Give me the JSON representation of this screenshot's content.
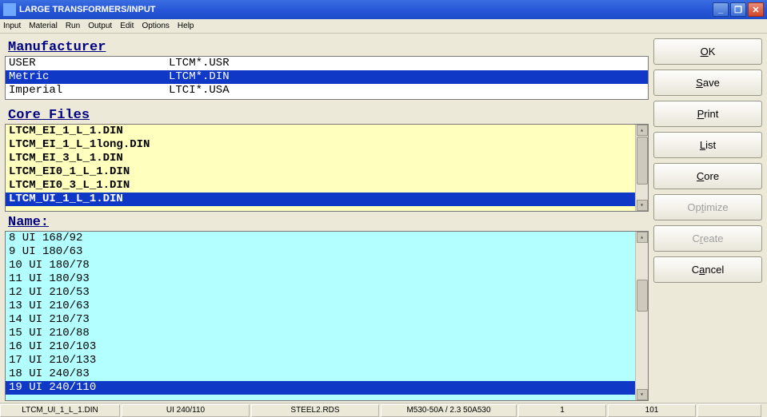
{
  "window": {
    "title": "LARGE TRANSFORMERS/INPUT"
  },
  "menu": {
    "items": [
      "Input",
      "Material",
      "Run",
      "Output",
      "Edit",
      "Options",
      "Help"
    ]
  },
  "sections": {
    "manufacturer_label": "Manufacturer",
    "corefiles_label": "Core Files",
    "name_label": "Name:"
  },
  "manufacturer": {
    "rows": [
      {
        "name": "USER",
        "pattern": "LTCM*.USR",
        "selected": false
      },
      {
        "name": "Metric",
        "pattern": "LTCM*.DIN",
        "selected": true
      },
      {
        "name": "Imperial",
        "pattern": "LTCI*.USA",
        "selected": false
      }
    ]
  },
  "core_files": {
    "rows": [
      {
        "name": "LTCM_EI_1_L_1.DIN",
        "selected": false
      },
      {
        "name": "LTCM_EI_1_L_1long.DIN",
        "selected": false
      },
      {
        "name": "LTCM_EI_3_L_1.DIN",
        "selected": false
      },
      {
        "name": "LTCM_EI0_1_L_1.DIN",
        "selected": false
      },
      {
        "name": "LTCM_EI0_3_L_1.DIN",
        "selected": false
      },
      {
        "name": "LTCM_UI_1_L_1.DIN",
        "selected": true
      }
    ]
  },
  "names": {
    "rows": [
      {
        "text": "8 UI 168/92",
        "selected": false
      },
      {
        "text": "9 UI 180/63",
        "selected": false
      },
      {
        "text": "10 UI 180/78",
        "selected": false
      },
      {
        "text": "11 UI 180/93",
        "selected": false
      },
      {
        "text": "12 UI 210/53",
        "selected": false
      },
      {
        "text": "13 UI 210/63",
        "selected": false
      },
      {
        "text": "14 UI 210/73",
        "selected": false
      },
      {
        "text": "15 UI 210/88",
        "selected": false
      },
      {
        "text": "16 UI 210/103",
        "selected": false
      },
      {
        "text": "17 UI 210/133",
        "selected": false
      },
      {
        "text": "18 UI 240/83",
        "selected": false
      },
      {
        "text": "19 UI 240/110",
        "selected": true
      }
    ]
  },
  "buttons": {
    "ok": {
      "pre": "",
      "u": "O",
      "post": "K",
      "disabled": false
    },
    "save": {
      "pre": "",
      "u": "S",
      "post": "ave",
      "disabled": false
    },
    "print": {
      "pre": "",
      "u": "P",
      "post": "rint",
      "disabled": false
    },
    "list": {
      "pre": "",
      "u": "L",
      "post": "ist",
      "disabled": false
    },
    "core": {
      "pre": "",
      "u": "C",
      "post": "ore",
      "disabled": false
    },
    "optimize": {
      "pre": "Op",
      "u": "t",
      "post": "imize",
      "disabled": true
    },
    "create": {
      "pre": "C",
      "u": "r",
      "post": "eate",
      "disabled": true
    },
    "cancel": {
      "pre": "C",
      "u": "a",
      "post": "ncel",
      "disabled": false
    }
  },
  "statusbar": {
    "cells": [
      "LTCM_UI_1_L_1.DIN",
      "UI 240/110",
      "STEEL2.RDS",
      "M530-50A / 2.3 50A530",
      "1",
      "101",
      ""
    ]
  }
}
